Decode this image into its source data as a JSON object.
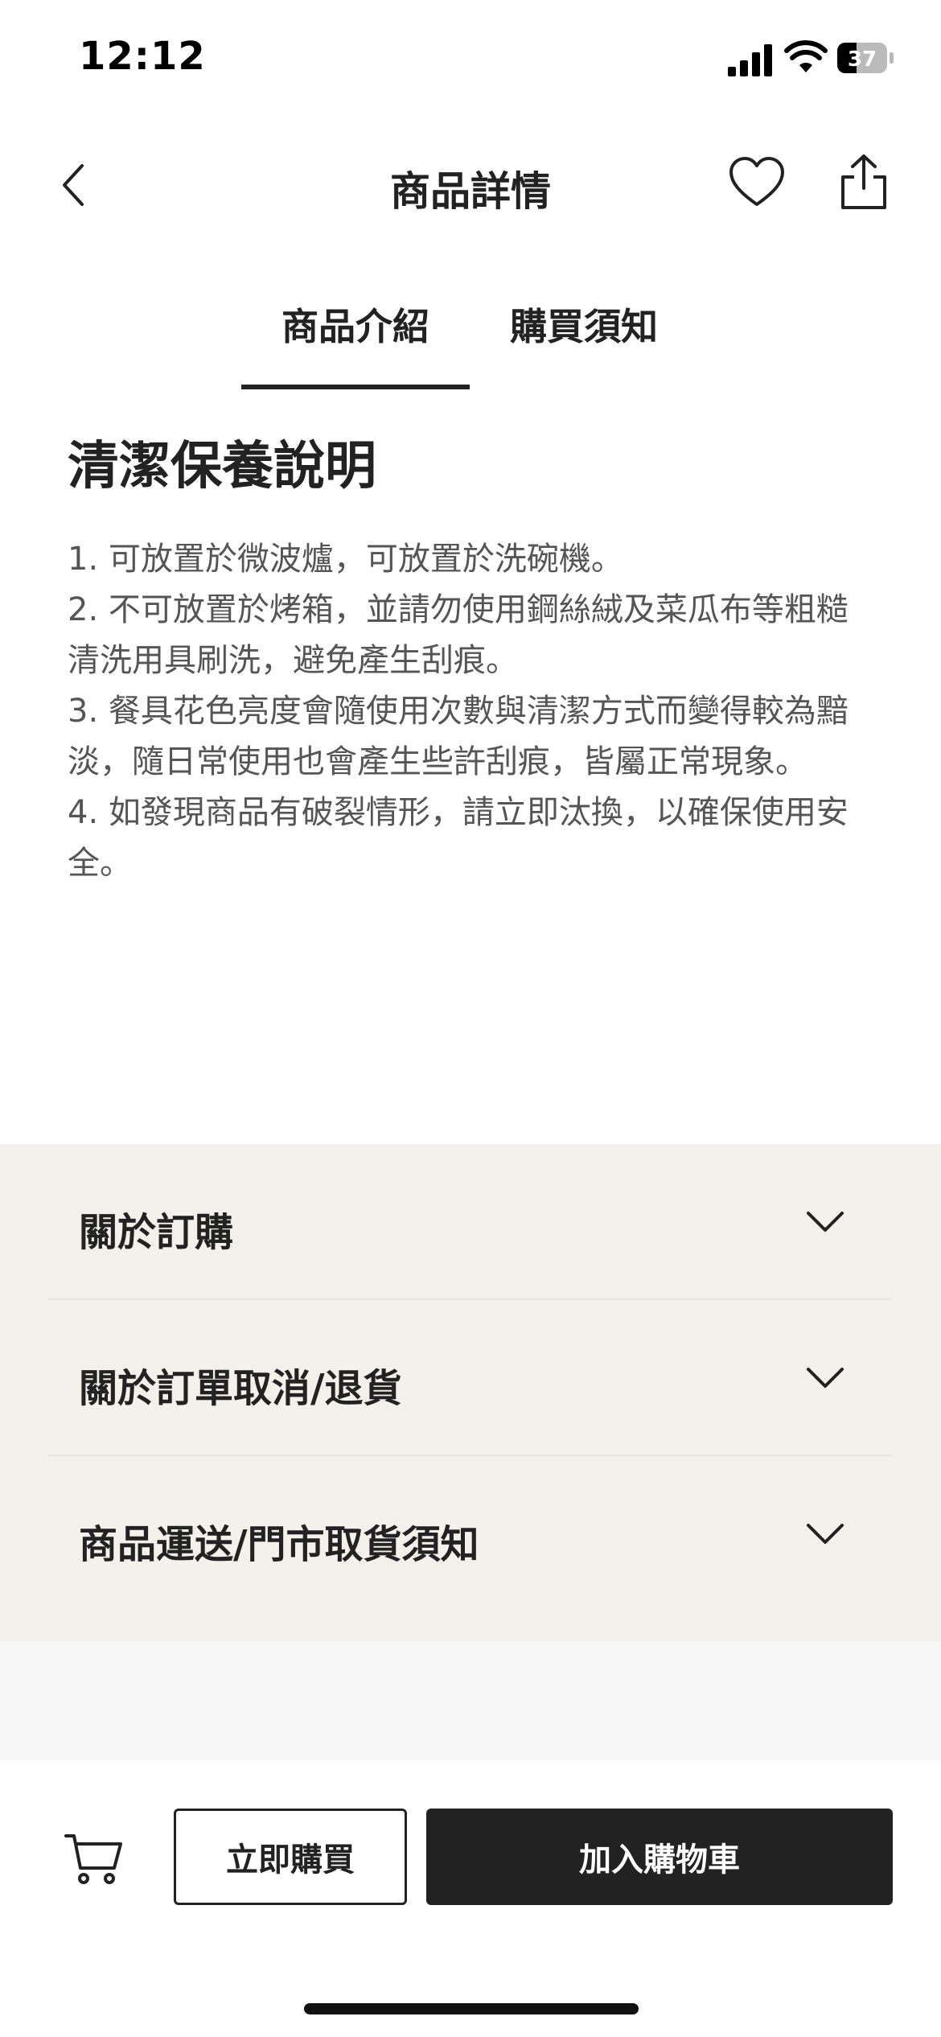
{
  "status_bar": {
    "time": "12:12",
    "battery_level": "37",
    "icons": [
      "signal-icon",
      "wifi-icon",
      "battery-icon"
    ]
  },
  "nav": {
    "title": "商品詳情",
    "icons": [
      "back-icon",
      "heart-icon",
      "share-icon"
    ]
  },
  "tabs": [
    {
      "label": "商品介紹",
      "active": true
    },
    {
      "label": "購買須知",
      "active": false
    }
  ],
  "care": {
    "title": "清潔保養說明",
    "items": [
      "1. 可放置於微波爐，可放置於洗碗機。",
      "2. 不可放置於烤箱，並請勿使用鋼絲絨及菜瓜布等粗糙清洗用具刷洗，避免產生刮痕。",
      "3. 餐具花色亮度會隨使用次數與清潔方式而變得較為黯淡，隨日常使用也會產生些許刮痕，皆屬正常現象。",
      "4. 如發現商品有破裂情形，請立即汰換，以確保使用安全。"
    ]
  },
  "accordion": [
    {
      "label": "關於訂購"
    },
    {
      "label": "關於訂單取消/退貨"
    },
    {
      "label": "商品運送/門市取貨須知"
    }
  ],
  "bottom_bar": {
    "buy_now_label": "立即購買",
    "add_to_cart_label": "加入購物車",
    "icons": [
      "cart-icon"
    ]
  },
  "colors": {
    "text_primary": "#222222",
    "text_secondary": "#555555",
    "accordion_bg": "#f2f1ec",
    "lower_bg": "#f7f7f7",
    "primary_button_bg": "#222222"
  }
}
